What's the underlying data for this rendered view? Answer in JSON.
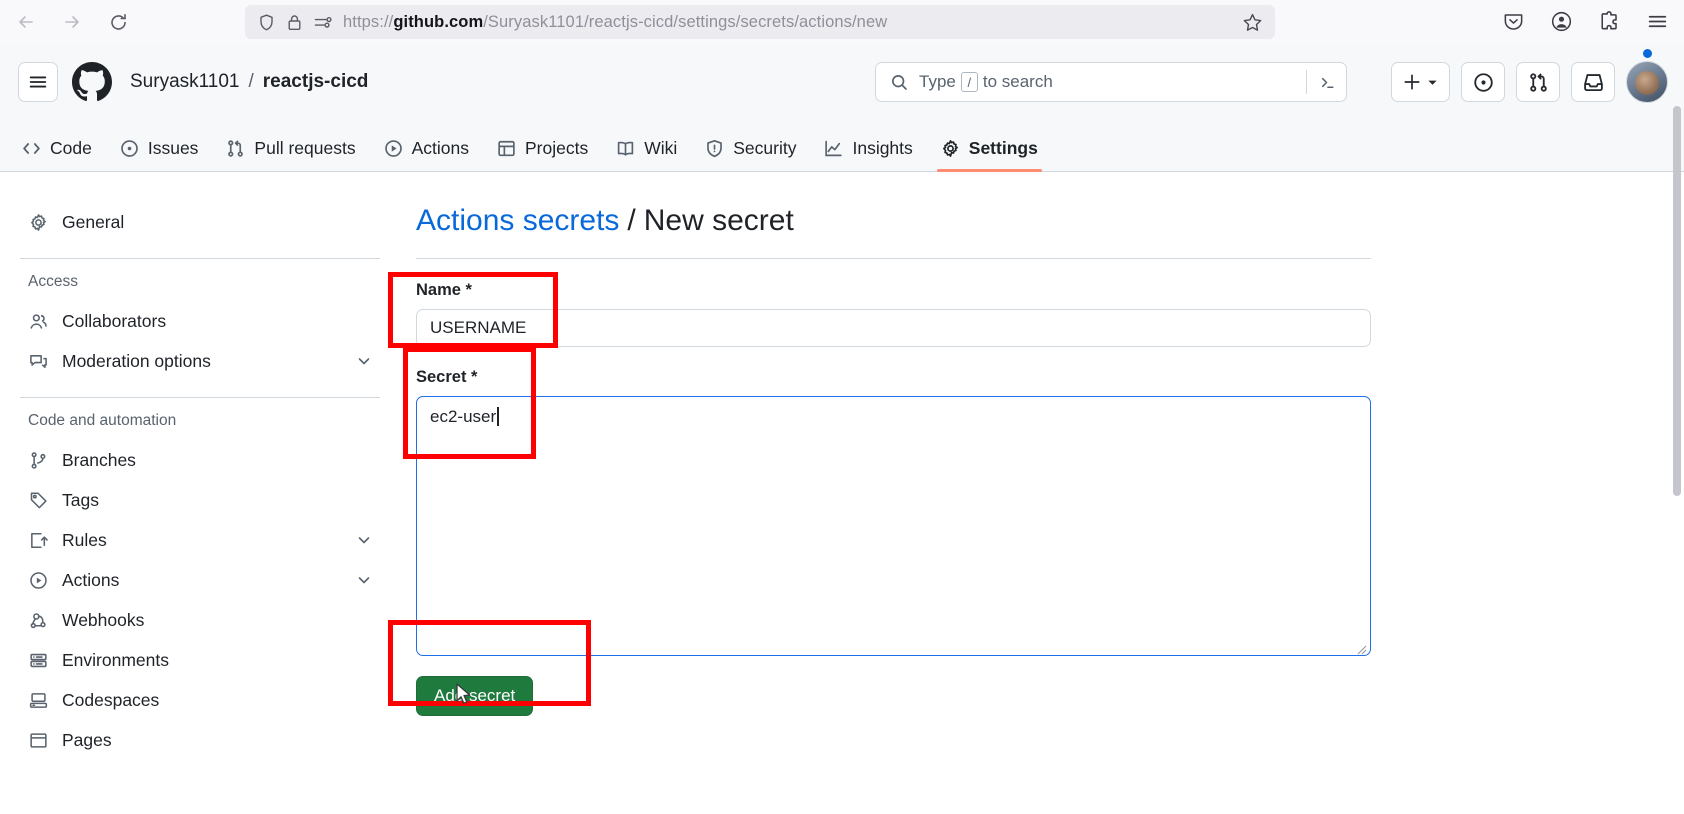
{
  "browser": {
    "back_icon": "arrow-left-icon",
    "forward_icon": "arrow-right-icon",
    "reload_icon": "reload-icon",
    "url_prefix": "https://",
    "url_domain": "github.com",
    "url_path": "/Suryask1101/reactjs-cicd/settings/secrets/actions/new",
    "full_url": "https://github.com/Suryask1101/reactjs-cicd/settings/secrets/actions/new",
    "icons": {
      "shield": "shield-icon",
      "lock": "lock-icon",
      "permissions": "permissions-icon",
      "bookmark": "star-icon",
      "pocket": "pocket-icon",
      "account": "account-icon",
      "extensions": "extensions-icon",
      "menu": "hamburger-menu-icon"
    }
  },
  "header": {
    "menu_icon": "hamburger-menu-icon",
    "logo_icon": "github-logo-icon",
    "owner": "Suryask1101",
    "separator": "/",
    "repo": "reactjs-cicd",
    "search": {
      "placeholder": "Type",
      "key_hint": "/",
      "placeholder_tail": "to search",
      "icon": "search-icon",
      "command_icon": "command-palette-icon"
    },
    "actions": {
      "create_new": "plus-icon",
      "create_new_chevron": "chevron-down-icon",
      "issues": "issues-icon",
      "pull_requests": "pull-request-icon",
      "notifications": "inbox-icon",
      "avatar": "user-avatar"
    }
  },
  "repo_nav": {
    "tabs": [
      {
        "label": "Code",
        "icon": "code-icon",
        "active": false
      },
      {
        "label": "Issues",
        "icon": "issues-icon",
        "active": false
      },
      {
        "label": "Pull requests",
        "icon": "pull-request-icon",
        "active": false
      },
      {
        "label": "Actions",
        "icon": "play-icon",
        "active": false
      },
      {
        "label": "Projects",
        "icon": "table-icon",
        "active": false
      },
      {
        "label": "Wiki",
        "icon": "book-icon",
        "active": false
      },
      {
        "label": "Security",
        "icon": "shield-alert-icon",
        "active": false
      },
      {
        "label": "Insights",
        "icon": "graph-icon",
        "active": false
      },
      {
        "label": "Settings",
        "icon": "gear-icon",
        "active": true
      }
    ]
  },
  "sidebar": {
    "general": {
      "label": "General",
      "icon": "gear-icon"
    },
    "groups": [
      {
        "title": "Access",
        "items": [
          {
            "label": "Collaborators",
            "icon": "people-icon",
            "expandable": false
          },
          {
            "label": "Moderation options",
            "icon": "comment-discussion-icon",
            "expandable": true
          }
        ]
      },
      {
        "title": "Code and automation",
        "items": [
          {
            "label": "Branches",
            "icon": "git-branch-icon",
            "expandable": false
          },
          {
            "label": "Tags",
            "icon": "tag-icon",
            "expandable": false
          },
          {
            "label": "Rules",
            "icon": "rules-icon",
            "expandable": true
          },
          {
            "label": "Actions",
            "icon": "play-icon",
            "expandable": true
          },
          {
            "label": "Webhooks",
            "icon": "webhook-icon",
            "expandable": false
          },
          {
            "label": "Environments",
            "icon": "server-icon",
            "expandable": false
          },
          {
            "label": "Codespaces",
            "icon": "codespaces-icon",
            "expandable": false
          },
          {
            "label": "Pages",
            "icon": "browser-icon",
            "expandable": false
          }
        ]
      }
    ]
  },
  "main": {
    "title_link": "Actions secrets",
    "title_sep": "/",
    "title_current": "New secret",
    "name_field": {
      "label": "Name *",
      "value": "USERNAME",
      "placeholder": ""
    },
    "secret_field": {
      "label": "Secret *",
      "value": "ec2-user",
      "placeholder": "",
      "focused": true
    },
    "submit_button": "Add secret"
  },
  "annotations": {
    "color": "#ff0000",
    "boxes": [
      {
        "name": "name-label-highlight"
      },
      {
        "name": "secret-label-highlight"
      },
      {
        "name": "add-secret-button-highlight"
      }
    ]
  },
  "colors": {
    "accent_blue": "#0969da",
    "focus_blue": "#1f6feb",
    "green_button": "#1f7a3d",
    "active_tab_underline": "#fd8c73",
    "header_bg": "#f6f8fa",
    "border": "#d1d9e0",
    "text": "#1f2328",
    "muted_text": "#59636e"
  }
}
